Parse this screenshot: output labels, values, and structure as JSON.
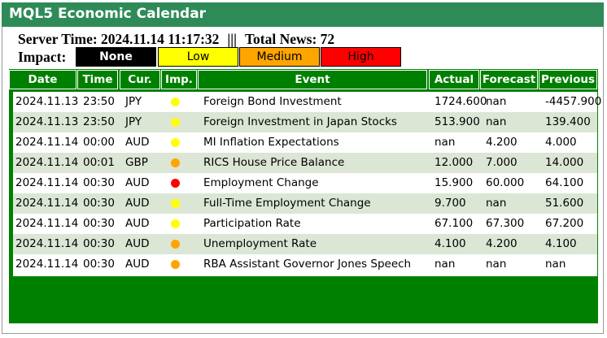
{
  "app": {
    "title": "MQL5 Economic Calendar"
  },
  "header": {
    "server_time": "Server Time: 2024.11.14 11:17:32",
    "separator": "|||",
    "total_news": "Total News: 72"
  },
  "impact": {
    "label": "Impact:",
    "buttons": {
      "none": "None",
      "low": "Low",
      "medium": "Medium",
      "high": "High"
    }
  },
  "colors": {
    "title_bar": "#2e8b57",
    "table_green": "#008000",
    "row_alt": "#dbe6d5",
    "impact_low": "#ffff00",
    "impact_medium": "#ffa500",
    "impact_high": "#ff0000"
  },
  "columns": {
    "date": "Date",
    "time": "Time",
    "currency": "Cur.",
    "importance": "Imp.",
    "event": "Event",
    "actual": "Actual",
    "forecast": "Forecast",
    "previous": "Previous"
  },
  "rows": [
    {
      "date": "2024.11.13",
      "time": "23:50",
      "currency": "JPY",
      "importance": "low",
      "event": "Foreign Bond Investment",
      "actual": "1724.600",
      "forecast": "nan",
      "previous": "-4457.900"
    },
    {
      "date": "2024.11.13",
      "time": "23:50",
      "currency": "JPY",
      "importance": "low",
      "event": "Foreign Investment in Japan Stocks",
      "actual": "513.900",
      "forecast": "nan",
      "previous": "139.400"
    },
    {
      "date": "2024.11.14",
      "time": "00:00",
      "currency": "AUD",
      "importance": "low",
      "event": "MI Inflation Expectations",
      "actual": "nan",
      "forecast": "4.200",
      "previous": "4.000"
    },
    {
      "date": "2024.11.14",
      "time": "00:01",
      "currency": "GBP",
      "importance": "medium",
      "event": "RICS House Price Balance",
      "actual": "12.000",
      "forecast": "7.000",
      "previous": "14.000"
    },
    {
      "date": "2024.11.14",
      "time": "00:30",
      "currency": "AUD",
      "importance": "high",
      "event": "Employment Change",
      "actual": "15.900",
      "forecast": "60.000",
      "previous": "64.100"
    },
    {
      "date": "2024.11.14",
      "time": "00:30",
      "currency": "AUD",
      "importance": "low",
      "event": "Full-Time Employment Change",
      "actual": "9.700",
      "forecast": "nan",
      "previous": "51.600"
    },
    {
      "date": "2024.11.14",
      "time": "00:30",
      "currency": "AUD",
      "importance": "low",
      "event": "Participation Rate",
      "actual": "67.100",
      "forecast": "67.300",
      "previous": "67.200"
    },
    {
      "date": "2024.11.14",
      "time": "00:30",
      "currency": "AUD",
      "importance": "medium",
      "event": "Unemployment Rate",
      "actual": "4.100",
      "forecast": "4.200",
      "previous": "4.100"
    },
    {
      "date": "2024.11.14",
      "time": "00:30",
      "currency": "AUD",
      "importance": "medium",
      "event": "RBA Assistant Governor Jones Speech",
      "actual": "nan",
      "forecast": "nan",
      "previous": "nan"
    }
  ]
}
